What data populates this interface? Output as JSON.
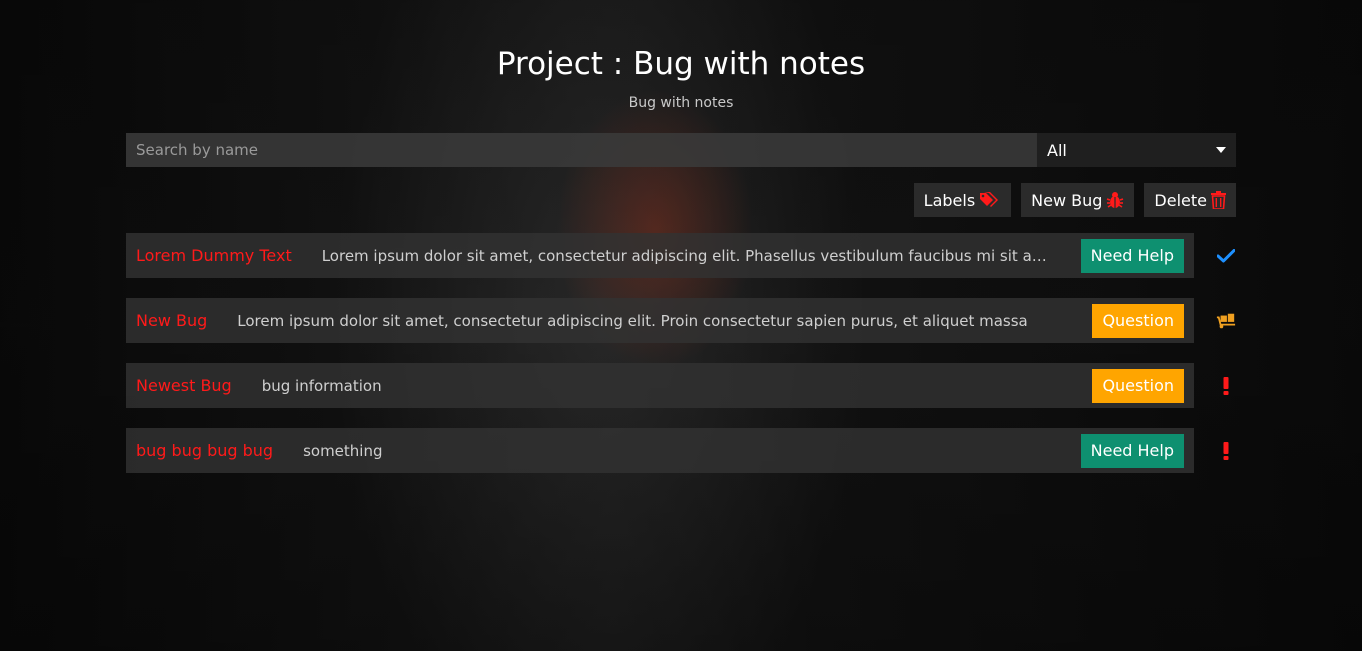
{
  "header": {
    "title": "Project : Bug with notes",
    "subtitle": "Bug with notes"
  },
  "search": {
    "placeholder": "Search by name",
    "value": ""
  },
  "filter": {
    "selected": "All"
  },
  "toolbar": {
    "labels_label": "Labels",
    "new_bug_label": "New Bug",
    "delete_label": "Delete"
  },
  "colors": {
    "accent_red": "#ff1a1a",
    "need_help": "#0e9070",
    "question": "#ffa500",
    "status_done": "#1e90ff",
    "status_progress": "#f0a020",
    "status_alert": "#ff1a1a"
  },
  "bugs": [
    {
      "name": "Lorem Dummy Text",
      "description": "Lorem ipsum dolor sit amet, consectetur adipiscing elit. Phasellus vestibulum faucibus mi sit amet",
      "label": "Need Help",
      "label_color": "#0e9070",
      "status_icon": "check-icon"
    },
    {
      "name": "New Bug",
      "description": "Lorem ipsum dolor sit amet, consectetur adipiscing elit. Proin consectetur sapien purus, et aliquet massa",
      "label": "Question",
      "label_color": "#ffa500",
      "status_icon": "dolly-icon"
    },
    {
      "name": "Newest Bug",
      "description": "bug information",
      "label": "Question",
      "label_color": "#ffa500",
      "status_icon": "exclamation-icon"
    },
    {
      "name": "bug bug bug bug",
      "description": "something",
      "label": "Need Help",
      "label_color": "#0e9070",
      "status_icon": "exclamation-icon"
    }
  ]
}
